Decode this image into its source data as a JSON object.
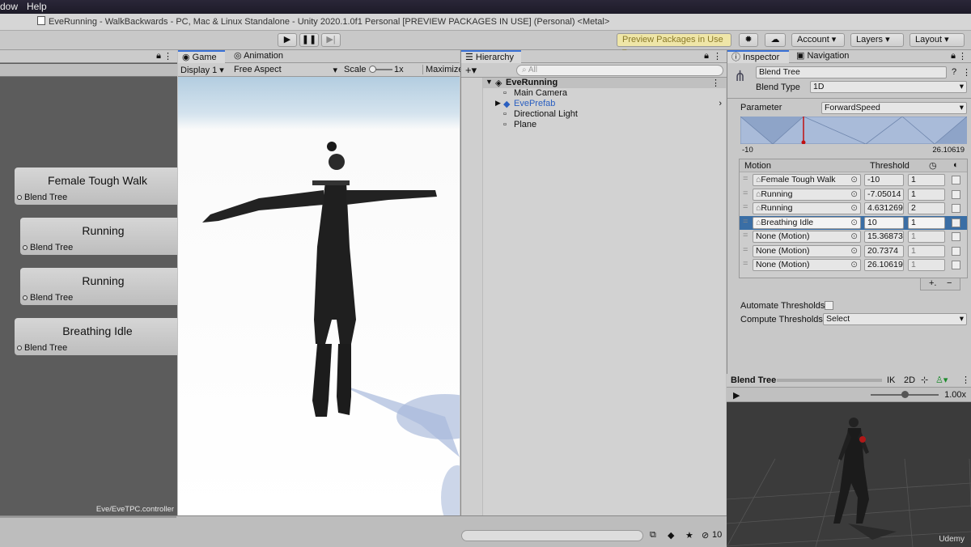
{
  "menubar": {
    "items": [
      "dow",
      "Help"
    ]
  },
  "window_title": "EveRunning - WalkBackwards - PC, Mac & Linux Standalone - Unity 2020.1.0f1 Personal [PREVIEW PACKAGES IN USE] (Personal) <Metal>",
  "toolbar": {
    "preview_packages": "Preview Packages in Use",
    "account": "Account",
    "layers": "Layers",
    "layout": "Layout"
  },
  "animator": {
    "nodes": [
      {
        "title": "Female Tough Walk",
        "sub": "Blend Tree"
      },
      {
        "title": "Running",
        "sub": "Blend Tree"
      },
      {
        "title": "Running",
        "sub": "Blend Tree"
      },
      {
        "title": "Breathing Idle",
        "sub": "Blend Tree"
      }
    ],
    "controller_path": "Eve/EveTPC.controller"
  },
  "game": {
    "tab_game": "Game",
    "tab_animation": "Animation",
    "display": "Display 1",
    "aspect": "Free Aspect",
    "scale_label": "Scale",
    "scale_value": "1x",
    "maximize": "Maximize"
  },
  "hierarchy": {
    "tab": "Hierarchy",
    "search_placeholder": "All",
    "root": "EveRunning",
    "items": [
      "Main Camera",
      "EvePrefab",
      "Directional Light",
      "Plane"
    ]
  },
  "inspector": {
    "tab_inspector": "Inspector",
    "tab_navigation": "Navigation",
    "name": "Blend Tree",
    "blend_type_label": "Blend Type",
    "blend_type": "1D",
    "parameter_label": "Parameter",
    "parameter": "ForwardSpeed",
    "range_min": "-10",
    "range_max": "26.10619",
    "motion_header": "Motion",
    "threshold_header": "Threshold",
    "rows": [
      {
        "motion": "Female Tough Walk",
        "threshold": "-10",
        "speed": "1"
      },
      {
        "motion": "Running",
        "threshold": "-7.05014",
        "speed": "1"
      },
      {
        "motion": "Running",
        "threshold": "4.631269",
        "speed": "2"
      },
      {
        "motion": "Breathing Idle",
        "threshold": "10",
        "speed": "1"
      },
      {
        "motion": "None (Motion)",
        "threshold": "15.36873",
        "speed": "1"
      },
      {
        "motion": "None (Motion)",
        "threshold": "20.7374",
        "speed": "1"
      },
      {
        "motion": "None (Motion)",
        "threshold": "26.10619",
        "speed": "1"
      }
    ],
    "automate_label": "Automate Thresholds",
    "compute_label": "Compute Thresholds",
    "compute_value": "Select"
  },
  "preview": {
    "title": "Blend Tree",
    "ik": "IK",
    "twod": "2D",
    "speed": "1.00x"
  },
  "status": {
    "count": "10",
    "watermark": "Udemy"
  },
  "colors": {
    "accent": "#3a72d8",
    "selection": "#3a6ea5"
  }
}
